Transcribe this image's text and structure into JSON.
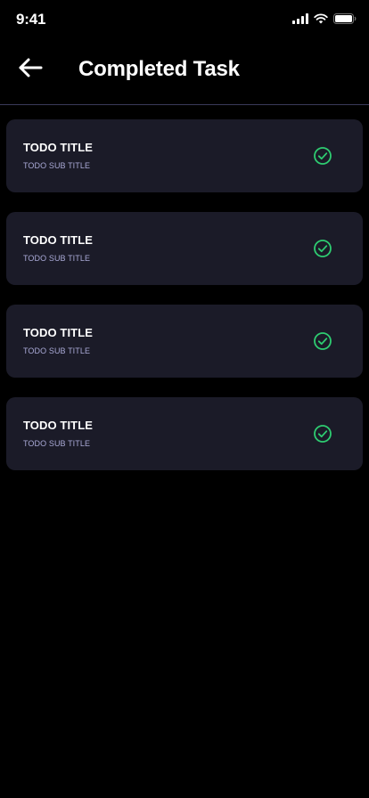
{
  "status_bar": {
    "time": "9:41",
    "icons": [
      "cellular-signal-icon",
      "wifi-icon",
      "battery-icon"
    ]
  },
  "header": {
    "back_icon": "arrow-left-icon",
    "title": "Completed Task"
  },
  "tasks": [
    {
      "title": "TODO TITLE",
      "subtitle": "TODO SUB TITLE",
      "completed": true
    },
    {
      "title": "TODO TITLE",
      "subtitle": "TODO SUB TITLE",
      "completed": true
    },
    {
      "title": "TODO TITLE",
      "subtitle": "TODO SUB TITLE",
      "completed": true
    },
    {
      "title": "TODO TITLE",
      "subtitle": "TODO SUB TITLE",
      "completed": true
    }
  ],
  "colors": {
    "background": "#000000",
    "card": "#1b1b28",
    "subtitle": "#a9a9d6",
    "check": "#2ecc71",
    "divider": "#3a3a5a"
  }
}
